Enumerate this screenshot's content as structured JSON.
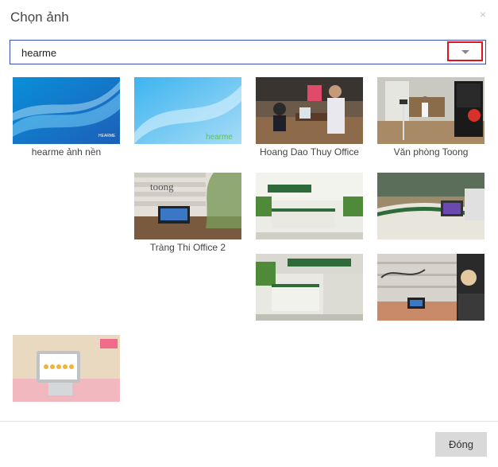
{
  "dialog": {
    "title": "Chọn ảnh",
    "close_label": "×"
  },
  "album_select": {
    "selected": "hearme",
    "icon": "chevron-down-icon"
  },
  "images": [
    {
      "caption": "hearme ảnh nền",
      "logo_text": "HEARME"
    },
    {
      "caption": "",
      "logo_text": "hearme"
    },
    {
      "caption": "Hoang Dao Thuy Office"
    },
    {
      "caption": "Văn phòng Toong"
    },
    {
      "caption": "Tràng Thi Office 2",
      "sign_text": "toong"
    },
    {
      "caption": ""
    },
    {
      "caption": ""
    },
    {
      "caption": ""
    },
    {
      "caption": ""
    },
    {
      "caption": ""
    }
  ],
  "footer": {
    "close_button": "Đóng"
  }
}
